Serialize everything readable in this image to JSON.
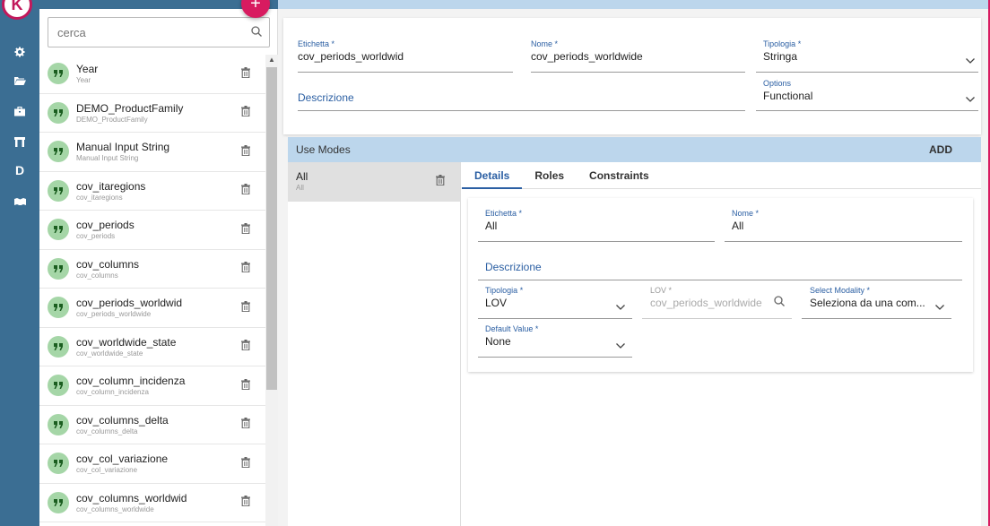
{
  "app": {
    "logo_letter": "K",
    "fab_label": "+"
  },
  "rail": {
    "icons": [
      "gear-icon",
      "folder-icon",
      "briefcase-icon",
      "store-icon",
      "d-icon",
      "map-icon"
    ],
    "d_letter": "D"
  },
  "search": {
    "placeholder": "cerca"
  },
  "list": [
    {
      "title": "Year",
      "subtitle": "Year"
    },
    {
      "title": "DEMO_ProductFamily",
      "subtitle": "DEMO_ProductFamily"
    },
    {
      "title": "Manual Input String",
      "subtitle": "Manual Input String"
    },
    {
      "title": "cov_itaregions",
      "subtitle": "cov_itaregions"
    },
    {
      "title": "cov_periods",
      "subtitle": "cov_periods"
    },
    {
      "title": "cov_columns",
      "subtitle": "cov_columns"
    },
    {
      "title": "cov_periods_worldwid",
      "subtitle": "cov_periods_worldwide"
    },
    {
      "title": "cov_worldwide_state",
      "subtitle": "cov_worldwide_state"
    },
    {
      "title": "cov_column_incidenza",
      "subtitle": "cov_column_incidenza"
    },
    {
      "title": "cov_columns_delta",
      "subtitle": "cov_columns_delta"
    },
    {
      "title": "cov_col_variazione",
      "subtitle": "cov_col_variazione"
    },
    {
      "title": "cov_columns_worldwid",
      "subtitle": "cov_columns_worldwide"
    }
  ],
  "form": {
    "etichetta_label": "Etichetta *",
    "etichetta_value": "cov_periods_worldwid",
    "nome_label": "Nome *",
    "nome_value": "cov_periods_worldwide",
    "tipologia_label": "Tipologia *",
    "tipologia_value": "Stringa",
    "descrizione_label": "Descrizione",
    "options_label": "Options",
    "options_value": "Functional"
  },
  "use_modes": {
    "title": "Use Modes",
    "add_label": "ADD",
    "items": [
      {
        "title": "All",
        "subtitle": "All"
      }
    ],
    "tabs": [
      "Details",
      "Roles",
      "Constraints"
    ],
    "details": {
      "etichetta_label": "Etichetta *",
      "etichetta_value": "All",
      "nome_label": "Nome *",
      "nome_value": "All",
      "descrizione_label": "Descrizione",
      "tipologia_label": "Tipologia *",
      "tipologia_value": "LOV",
      "lov_label": "LOV *",
      "lov_value": "cov_periods_worldwide",
      "select_modality_label": "Select Modality *",
      "select_modality_value": "Seleziona da una com...",
      "default_label": "Default Value *",
      "default_value": "None"
    }
  },
  "colors": {
    "rail": "#3b6e93",
    "accent": "#2b5fa3",
    "header": "#bcd6ec",
    "fab": "#d81b60",
    "avatar": "#a5d6a7"
  }
}
